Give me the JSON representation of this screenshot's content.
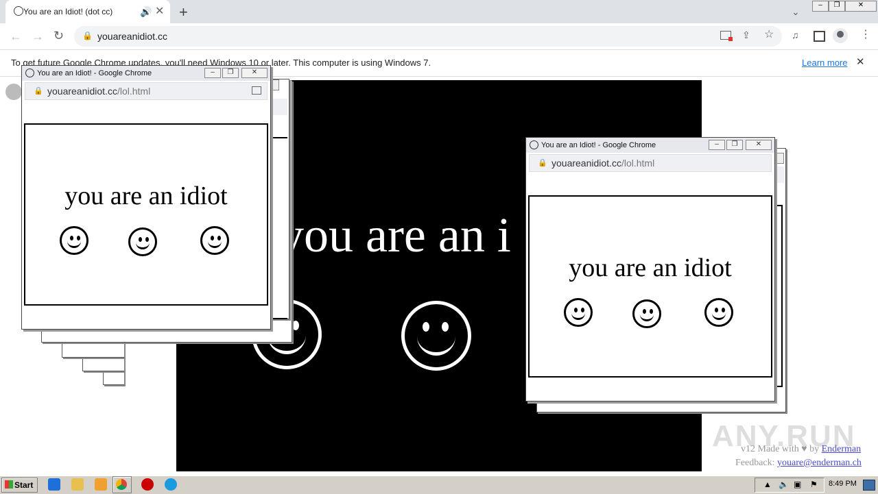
{
  "browser": {
    "tab_title": "You are an Idiot! (dot cc)",
    "url": "youareanidiot.cc",
    "infobar_text": "To get future Google Chrome updates, you'll need Windows 10 or later. This computer is using Windows 7.",
    "learn_more": "Learn more",
    "new_tab": "+"
  },
  "page": {
    "big_text": "you are an i",
    "footer_made": "v12 Made with ♥ by ",
    "footer_author": "Enderman",
    "footer_feedback_label": "Feedback: ",
    "footer_email": "youare@enderman.ch",
    "watermark": "ANY.RUN"
  },
  "popups": [
    {
      "title": "You are an Idiot! - Google Chrome",
      "domain": "youareanidiot.cc",
      "path": "/lol.html",
      "text": "you are an idiot"
    },
    {
      "title": "You are an Idiot! - Google Chrome",
      "domain": "youareanidiot.cc",
      "path": "/lol.html",
      "text": "you are an idiot"
    }
  ],
  "taskbar": {
    "start": "Start",
    "clock": "8:49 PM"
  }
}
